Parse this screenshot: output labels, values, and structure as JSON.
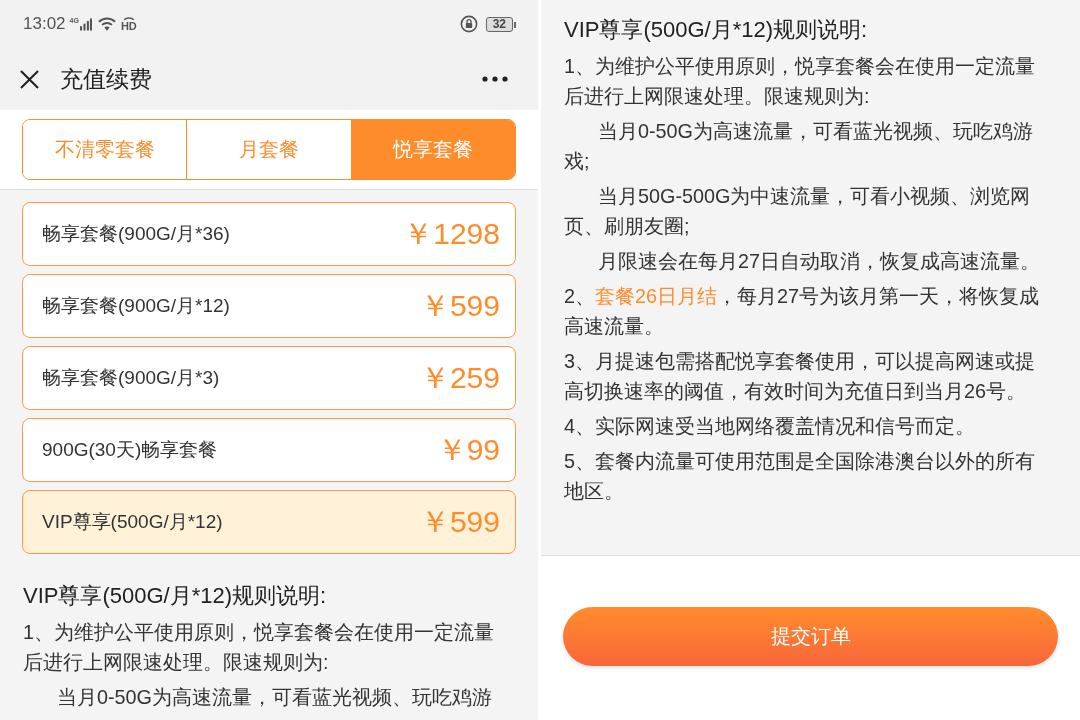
{
  "left_screen": {
    "status_bar": {
      "time": "13:02",
      "network_label": "4G",
      "hd_label": "HD",
      "battery": "32"
    },
    "header": {
      "title": "充值续费"
    },
    "tabs": [
      {
        "label": "不清零套餐",
        "selected": false
      },
      {
        "label": "月套餐",
        "selected": false
      },
      {
        "label": "悦享套餐",
        "selected": true
      }
    ],
    "plans": [
      {
        "name": "畅享套餐(900G/月*36)",
        "price": "￥1298",
        "selected": false
      },
      {
        "name": "畅享套餐(900G/月*12)",
        "price": "￥599",
        "selected": false
      },
      {
        "name": "畅享套餐(900G/月*3)",
        "price": "￥259",
        "selected": false
      },
      {
        "name": "900G(30天)畅享套餐",
        "price": "￥99",
        "selected": false
      },
      {
        "name": "VIP尊享(500G/月*12)",
        "price": "￥599",
        "selected": true
      }
    ],
    "rules": {
      "heading": "VIP尊享(500G/月*12)规则说明:",
      "paragraphs": [
        {
          "indent": false,
          "segments": [
            {
              "text": "1、为维护公平使用原则，悦享套餐会在使用一定流量后进行上网限速处理。限速规则为:",
              "highlight": false
            }
          ]
        },
        {
          "indent": true,
          "segments": [
            {
              "text": "当月0-50G为高速流量，可看蓝光视频、玩吃鸡游",
              "highlight": false
            }
          ]
        }
      ]
    }
  },
  "right_screen": {
    "rules": {
      "heading": "VIP尊享(500G/月*12)规则说明:",
      "paragraphs": [
        {
          "indent": false,
          "segments": [
            {
              "text": "1、为维护公平使用原则，悦享套餐会在使用一定流量后进行上网限速处理。限速规则为:",
              "highlight": false
            }
          ]
        },
        {
          "indent": true,
          "segments": [
            {
              "text": "当月0-50G为高速流量，可看蓝光视频、玩吃鸡游戏;",
              "highlight": false
            }
          ]
        },
        {
          "indent": true,
          "segments": [
            {
              "text": "当月50G-500G为中速流量，可看小视频、浏览网页、刷朋友圈;",
              "highlight": false
            }
          ]
        },
        {
          "indent": true,
          "segments": [
            {
              "text": "月限速会在每月27日自动取消，恢复成高速流量。",
              "highlight": false
            }
          ]
        },
        {
          "indent": false,
          "segments": [
            {
              "text": "2、",
              "highlight": false
            },
            {
              "text": "套餐26日月结",
              "highlight": true
            },
            {
              "text": "，每月27号为该月第一天，将恢复成高速流量。",
              "highlight": false
            }
          ]
        },
        {
          "indent": false,
          "segments": [
            {
              "text": "3、月提速包需搭配悦享套餐使用，可以提高网速或提高切换速率的阈值，有效时间为充值日到当月26号。",
              "highlight": false
            }
          ]
        },
        {
          "indent": false,
          "segments": [
            {
              "text": "4、实际网速受当地网络覆盖情况和信号而定。",
              "highlight": false
            }
          ]
        },
        {
          "indent": false,
          "segments": [
            {
              "text": "5、套餐内流量可使用范围是全国除港澳台以外的所有地区。",
              "highlight": false
            }
          ]
        }
      ]
    },
    "submit_button": "提交订单"
  }
}
